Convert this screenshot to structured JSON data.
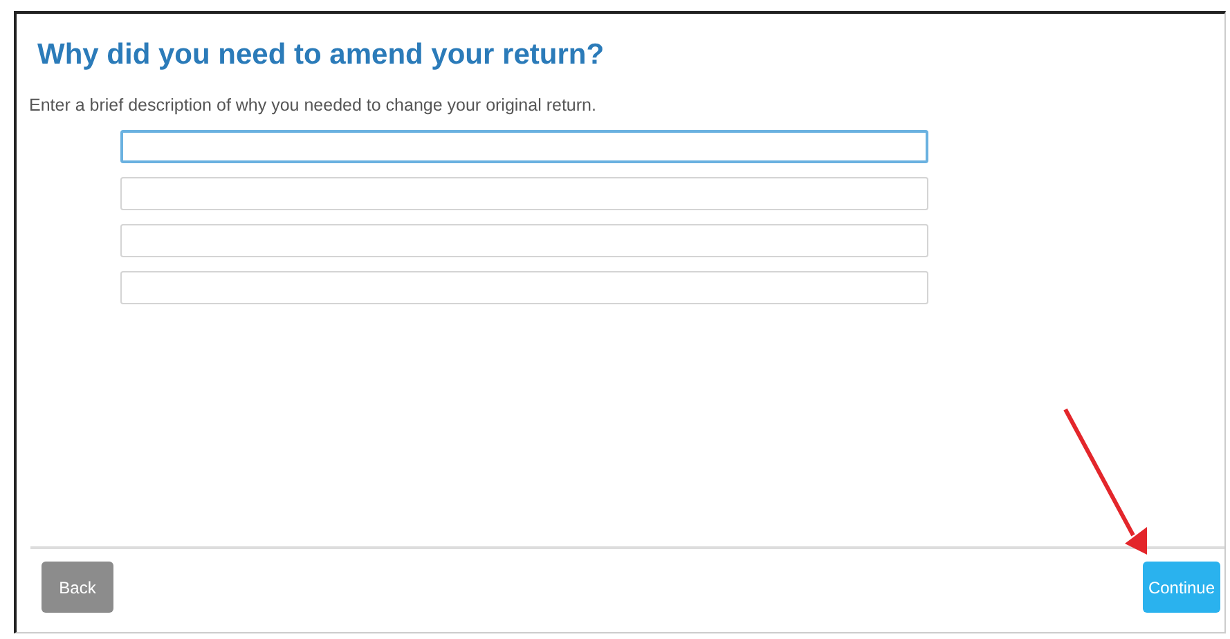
{
  "title": "Why did you need to amend your return?",
  "instruction": "Enter a brief description of why you needed to change your original return.",
  "fields": [
    {
      "focused": true
    },
    {
      "focused": false
    },
    {
      "focused": false
    },
    {
      "focused": false
    }
  ],
  "buttons": [
    {
      "label": "Back",
      "kind": "secondary"
    },
    {
      "label": "Continue",
      "kind": "primary"
    }
  ]
}
